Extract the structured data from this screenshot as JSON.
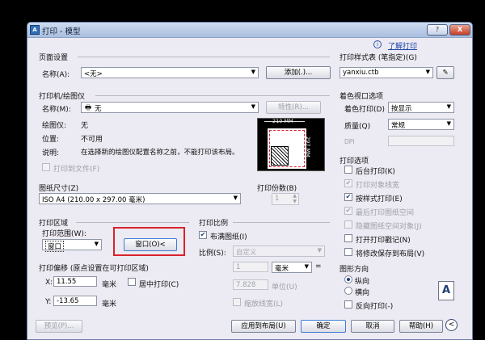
{
  "window": {
    "title": "打印 - 模型",
    "help_label": "?",
    "close_label": "X"
  },
  "learn_link": "了解打印",
  "page_setup": {
    "heading": "页面设置",
    "name_label": "名称(A):",
    "name_value": "<无>",
    "add_button": "添加(.)..."
  },
  "printer": {
    "heading": "打印机/绘图仪",
    "name_label": "名称(M):",
    "name_value": "无",
    "properties_button": "特性(R)...",
    "plotter_label": "绘图仪:",
    "plotter_value": "无",
    "location_label": "位置:",
    "location_value": "不可用",
    "desc_label": "说明:",
    "desc_value": "在选择新的绘图仪配置名称之前，不能打印该布局。",
    "print_to_file": "打印到文件(F)",
    "preview_width": "210 MM",
    "preview_height": "297 MM"
  },
  "paper": {
    "heading": "图纸尺寸(Z)",
    "value": "ISO A4 (210.00 x 297.00 毫米)"
  },
  "copies": {
    "heading": "打印份数(B)",
    "value": "1"
  },
  "area": {
    "heading": "打印区域",
    "range_label": "打印范围(W):",
    "range_value": "窗口",
    "window_button": "窗口(O)<"
  },
  "offset": {
    "heading": "打印偏移 (原点设置在可打印区域)",
    "x_label": "X:",
    "x_value": "11.55",
    "x_unit": "毫米",
    "y_label": "Y:",
    "y_value": "-13.65",
    "y_unit": "毫米",
    "center_label": "居中打印(C)"
  },
  "scale": {
    "heading": "打印比例",
    "fit_label": "布满图纸(I)",
    "ratio_label": "比例(S):",
    "ratio_value": "自定义",
    "num_value": "1",
    "unit_value": "毫米",
    "eq": "=",
    "den_value": "7.828",
    "unit_label": "单位(U)",
    "lineweight_label": "缩放线宽(L)"
  },
  "style_table": {
    "heading": "打印样式表 (笔指定)(G)",
    "value": "yanxiu.ctb"
  },
  "shaded": {
    "heading": "着色视口选项",
    "shade_label": "着色打印(D)",
    "shade_value": "按显示",
    "quality_label": "质量(Q)",
    "quality_value": "常规",
    "dpi_label": "DPI"
  },
  "options": {
    "heading": "打印选项",
    "items": [
      {
        "label": "后台打印(K)",
        "checked": false,
        "disabled": false
      },
      {
        "label": "打印对象线宽",
        "checked": true,
        "disabled": true
      },
      {
        "label": "按样式打印(E)",
        "checked": true,
        "disabled": false
      },
      {
        "label": "最后打印图纸空间",
        "checked": true,
        "disabled": true
      },
      {
        "label": "隐藏图纸空间对象(J)",
        "checked": false,
        "disabled": true
      },
      {
        "label": "打开打印戳记(N)",
        "checked": false,
        "disabled": false
      },
      {
        "label": "将修改保存到布局(V)",
        "checked": false,
        "disabled": false
      }
    ]
  },
  "orientation": {
    "heading": "图形方向",
    "portrait": "纵向",
    "landscape": "横向",
    "reverse": "反向打印(-)",
    "icon_letter": "A"
  },
  "footer": {
    "preview": "预览(P)...",
    "apply": "应用到布局(U)",
    "ok": "确定",
    "cancel": "取消",
    "help": "帮助(H)",
    "expand_label": "<"
  }
}
